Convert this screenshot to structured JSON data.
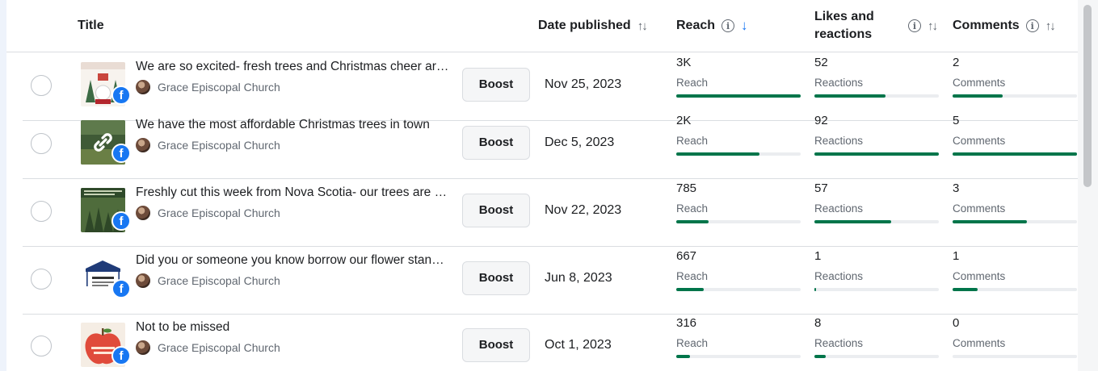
{
  "header": {
    "title": "Title",
    "date_published": "Date published",
    "reach": "Reach",
    "likes_line1": "Likes and",
    "likes_line2": "reactions",
    "comments": "Comments"
  },
  "colors": {
    "bar": "#00754a",
    "track": "#ebedf0",
    "facebook": "#1877f2",
    "sort_active": "#1877f2"
  },
  "icons": {
    "sort": "↑↓",
    "sort_active": "↓",
    "info": "i",
    "facebook": "f",
    "link": "link-icon"
  },
  "rows": [
    {
      "title": "We are so excited- fresh trees and Christmas cheer are here!",
      "page": "Grace Episcopal Church",
      "boost": "Boost",
      "date": "Nov 25, 2023",
      "reach": {
        "value": "3K",
        "label": "Reach",
        "fraction": 1.0
      },
      "reactions": {
        "value": "52",
        "label": "Reactions",
        "fraction": 0.57
      },
      "comments": {
        "value": "2",
        "label": "Comments",
        "fraction": 0.4
      },
      "thumb": "christmas-tree-sale-thumbnail"
    },
    {
      "title": "We have the most affordable Christmas trees in town",
      "page": "Grace Episcopal Church",
      "boost": "Boost",
      "date": "Dec 5, 2023",
      "reach": {
        "value": "2K",
        "label": "Reach",
        "fraction": 0.67
      },
      "reactions": {
        "value": "92",
        "label": "Reactions",
        "fraction": 1.0
      },
      "comments": {
        "value": "5",
        "label": "Comments",
        "fraction": 1.0
      },
      "thumb": "link-post-thumbnail"
    },
    {
      "title": "Freshly cut this week from Nova Scotia- our trees are here",
      "page": "Grace Episcopal Church",
      "boost": "Boost",
      "date": "Nov 22, 2023",
      "reach": {
        "value": "785",
        "label": "Reach",
        "fraction": 0.26
      },
      "reactions": {
        "value": "57",
        "label": "Reactions",
        "fraction": 0.62
      },
      "comments": {
        "value": "3",
        "label": "Comments",
        "fraction": 0.6
      },
      "thumb": "tree-field-thumbnail"
    },
    {
      "title": "Did you or someone you know borrow our flower stand tent",
      "page": "Grace Episcopal Church",
      "boost": "Boost",
      "date": "Jun 8, 2023",
      "reach": {
        "value": "667",
        "label": "Reach",
        "fraction": 0.22
      },
      "reactions": {
        "value": "1",
        "label": "Reactions",
        "fraction": 0.011
      },
      "comments": {
        "value": "1",
        "label": "Comments",
        "fraction": 0.2
      },
      "thumb": "missing-tent-thumbnail"
    },
    {
      "title": "Not to be missed",
      "page": "Grace Episcopal Church",
      "boost": "Boost",
      "date": "Oct 1, 2023",
      "reach": {
        "value": "316",
        "label": "Reach",
        "fraction": 0.11
      },
      "reactions": {
        "value": "8",
        "label": "Reactions",
        "fraction": 0.09
      },
      "comments": {
        "value": "0",
        "label": "Comments",
        "fraction": 0.0
      },
      "thumb": "apple-sale-thumbnail"
    }
  ]
}
